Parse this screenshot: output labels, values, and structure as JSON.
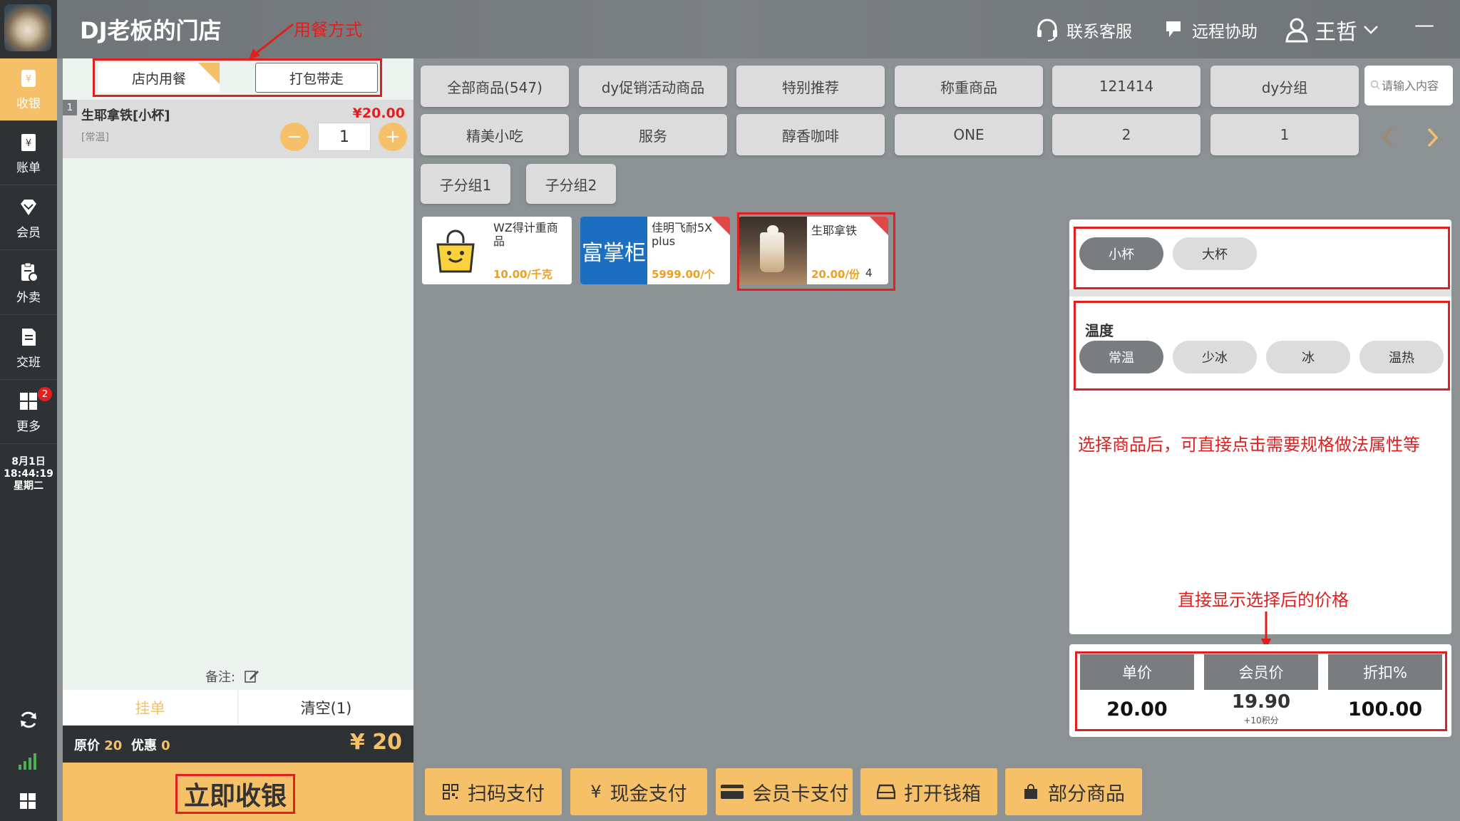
{
  "header": {
    "store_name": "DJ老板的门店",
    "annotation_dining": "用餐方式",
    "support_label": "联系客服",
    "remote_label": "远程协助",
    "user_name": "王哲",
    "minimize": "—"
  },
  "sidebar": {
    "items": [
      {
        "label": "收银",
        "icon": "cashier-icon"
      },
      {
        "label": "账单",
        "icon": "bill-icon"
      },
      {
        "label": "会员",
        "icon": "member-icon"
      },
      {
        "label": "外卖",
        "icon": "takeout-icon"
      },
      {
        "label": "交班",
        "icon": "shift-icon"
      },
      {
        "label": "更多",
        "icon": "more-apps-icon"
      }
    ],
    "more_badge": "2",
    "date": "8月1日",
    "time": "18:44:19",
    "weekday": "星期二"
  },
  "cart": {
    "dining_tabs": [
      "店内用餐",
      "打包带走"
    ],
    "items": [
      {
        "index": "1",
        "name": "生耶拿铁[小杯]",
        "price": "¥20.00",
        "spec": "[常温]",
        "qty": "1"
      }
    ],
    "note_label": "备注:",
    "hold_label": "挂单",
    "clear_label": "清空(1)",
    "original_label": "原价",
    "original_value": "20",
    "discount_label": "优惠",
    "discount_value": "0",
    "total": "¥ 20",
    "checkout_label": "立即收银"
  },
  "categories": {
    "row1": [
      "全部商品(547)",
      "dy促销活动商品",
      "特别推荐",
      "称重商品",
      "121414",
      "dy分组"
    ],
    "row2": [
      "精美小吃",
      "服务",
      "醇香咖啡",
      "ONE",
      "2",
      "1"
    ],
    "row3": [
      "子分组1",
      "子分组2"
    ],
    "search_placeholder": "请输入内容"
  },
  "products": [
    {
      "name": "WZ得计重商品",
      "price": "10.00/千克",
      "qty": ""
    },
    {
      "name": "佳明飞耐5X plus",
      "price": "5999.00/个",
      "qty": "",
      "image_text": "富掌柜"
    },
    {
      "name": "生耶拿铁",
      "price": "20.00/份",
      "qty": "4"
    }
  ],
  "spec_panel": {
    "sizes": [
      "小杯",
      "大杯"
    ],
    "temp_title": "温度",
    "temps": [
      "常温",
      "少冰",
      "冰",
      "温热"
    ],
    "annotation_select": "选择商品后，可直接点击需要规格做法属性等",
    "annotation_price": "直接显示选择后的价格"
  },
  "price_panel": {
    "unit_label": "单价",
    "unit_value": "20.00",
    "member_label": "会员价",
    "member_value": "19.90",
    "member_points": "+10积分",
    "discount_label": "折扣%",
    "discount_value": "100.00"
  },
  "payments": [
    "扫码支付",
    "现金支付",
    "会员卡支付",
    "打开钱箱",
    "部分商品"
  ],
  "colors": {
    "accent": "#f6c068",
    "price_red": "#e02020",
    "sidebar": "#2f3234"
  }
}
